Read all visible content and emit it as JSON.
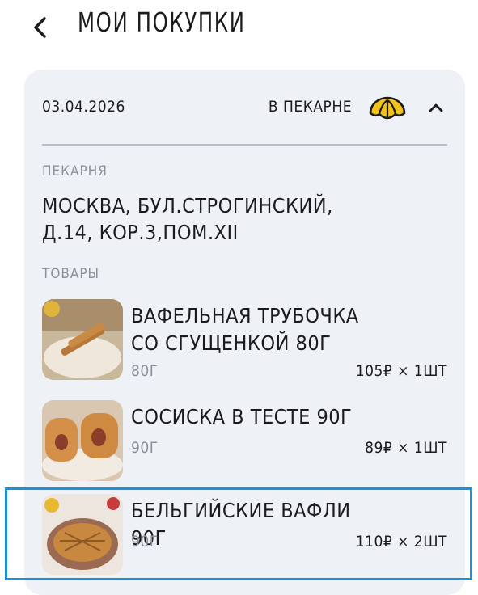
{
  "header": {
    "title": "МОИ ПОКУПКИ",
    "back_icon": "chevron-left-icon"
  },
  "order": {
    "date": "03.04.2026",
    "place": "В ПЕКАРНЕ",
    "place_icon": "croissant-icon",
    "toggle_icon": "chevron-up-icon",
    "bakery_label": "ПЕКАРНЯ",
    "address": "МОСКВА, БУЛ.СТРОГИНСКИЙ, Д.14, КОР.3,ПОМ.XII",
    "goods_label": "ТОВАРЫ",
    "items": [
      {
        "name": "ВАФЕЛЬНАЯ ТРУБОЧКА СО СГУЩЕНКОЙ 80Г",
        "weight": "80Г",
        "price": "105₽ × 1ШТ"
      },
      {
        "name": "СОСИСКА В ТЕСТЕ 90Г",
        "weight": "90Г",
        "price": "89₽ × 1ШТ"
      },
      {
        "name": "БЕЛЬГИЙСКИЕ ВАФЛИ 90Г",
        "weight": "90Г",
        "price": "110₽ × 2ШТ"
      }
    ]
  },
  "colors": {
    "card_bg": "#eef1f6",
    "accent_yellow": "#f2c21a",
    "highlight": "#1e90d6",
    "muted": "#8c909b"
  }
}
